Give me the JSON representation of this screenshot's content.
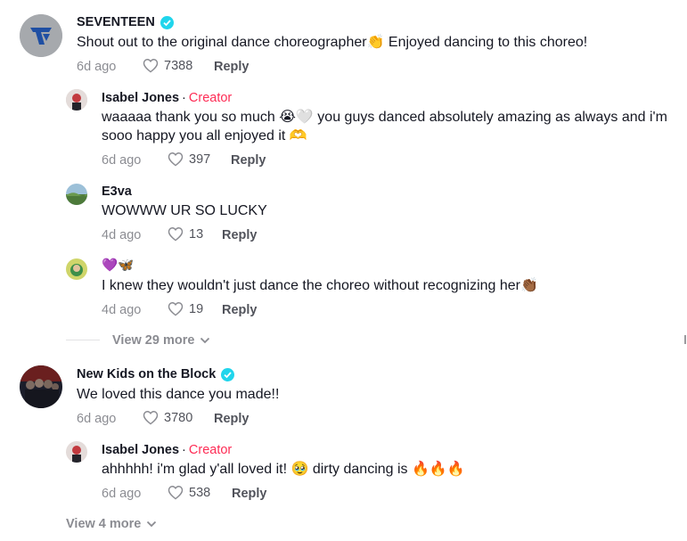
{
  "comments": [
    {
      "author": "SEVENTEEN",
      "verified": true,
      "text": "Shout out to the original dance choreographer👏 Enjoyed dancing to this choreo!",
      "time": "6d ago",
      "likes": "7388",
      "reply_label": "Reply",
      "replies": [
        {
          "author": "Isabel Jones",
          "separator": "·",
          "badge": "Creator",
          "text_line1": "waaaaa thank you so much 😭🤍 you guys danced absolutely amazing as always and i'm",
          "text_line2": "sooo happy you all enjoyed it 🫶",
          "time": "6d ago",
          "likes": "397",
          "reply_label": "Reply"
        },
        {
          "author": "E3va",
          "text": "WOWWW UR SO LUCKY",
          "time": "4d ago",
          "likes": "13",
          "reply_label": "Reply"
        },
        {
          "author": "💜🦋",
          "text": "I knew they wouldn't just dance the choreo without recognizing her👏🏾",
          "time": "4d ago",
          "likes": "19",
          "reply_label": "Reply"
        }
      ],
      "view_more": "View 29 more"
    },
    {
      "author": "New Kids on the Block",
      "verified": true,
      "text": "We loved this dance you made!!",
      "time": "6d ago",
      "likes": "3780",
      "reply_label": "Reply",
      "replies": [
        {
          "author": "Isabel Jones",
          "separator": "·",
          "badge": "Creator",
          "text": "ahhhhh! i'm glad y'all loved it! 🥹 dirty dancing is 🔥🔥🔥",
          "time": "6d ago",
          "likes": "538",
          "reply_label": "Reply"
        }
      ],
      "view_more": "View 4 more"
    }
  ],
  "colors": {
    "creator_badge": "#fe2c55",
    "verified": "#20d5ec",
    "primary_text": "#161823"
  },
  "icons": [
    "verified-icon",
    "heart-icon",
    "chevron-down-icon"
  ]
}
